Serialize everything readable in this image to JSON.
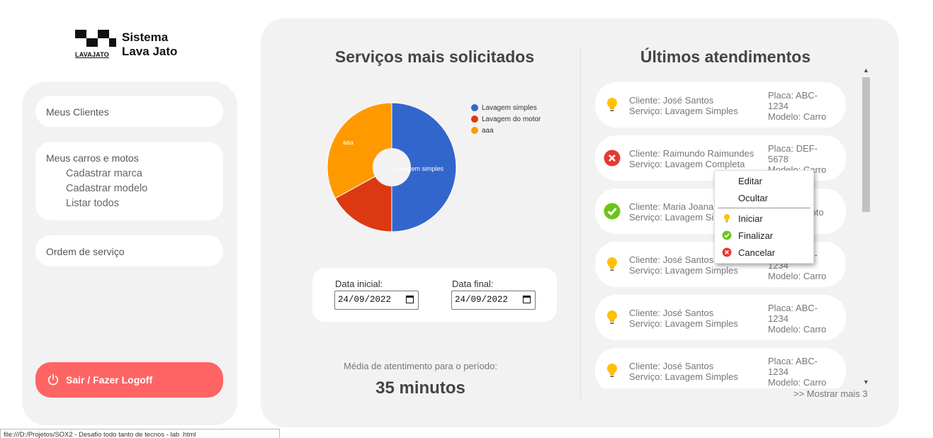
{
  "app": {
    "logo_line1": "Sistema",
    "logo_line2": "Lava Jato",
    "logo_badge": "LAVAJATO"
  },
  "sidebar": {
    "meus_clientes": "Meus Clientes",
    "carros_title": "Meus carros e motos",
    "carros_items": [
      "Cadastrar marca",
      "Cadastrar modelo",
      "Listar todos"
    ],
    "ordem_servico": "Ordem de serviço",
    "logoff_label": "Sair / Fazer Logoff"
  },
  "services": {
    "title": "Serviços mais solicitados",
    "legend": [
      "Lavagem simples",
      "Lavagem do motor",
      "aaa"
    ],
    "slice_labels": [
      "Lavagem simples",
      "aaa"
    ],
    "date_start_label": "Data inicial:",
    "date_start_value": "24/09/2022",
    "date_end_label": "Data final:",
    "date_end_value": "24/09/2022",
    "media_label": "Média de atentimento para o período:",
    "media_value": "35 minutos"
  },
  "chart_data": {
    "type": "pie",
    "title": "",
    "categories": [
      "Lavagem simples",
      "Lavagem do motor",
      "aaa"
    ],
    "values": [
      50,
      17,
      33
    ],
    "colors": [
      "#3366cc",
      "#dc3912",
      "#ff9900"
    ],
    "donut_hole": true,
    "legend_position": "top-right"
  },
  "atendimentos": {
    "title": "Últimos atendimentos",
    "items": [
      {
        "status_icon": "lightbulb-icon",
        "cliente": "Cliente: José Santos",
        "servico": "Serviço: Lavagem Simples",
        "placa": "Placa: ABC-1234",
        "modelo": "Modelo: Carro"
      },
      {
        "status_icon": "cancel-icon",
        "cliente": "Cliente: Raimundo Raimundes",
        "servico": "Serviço: Lavagem Completa",
        "placa": "Placa: DEF-5678",
        "modelo": "Modelo: Carro"
      },
      {
        "status_icon": "check-icon",
        "cliente": "Cliente: Maria Joana",
        "servico": "Serviço: Lavagem Simples",
        "placa": "Placa: ...",
        "modelo": "Modelo: Moto"
      },
      {
        "status_icon": "lightbulb-icon",
        "cliente": "Cliente: José Santos",
        "servico": "Serviço: Lavagem Simples",
        "placa": "Placa: ABC-1234",
        "modelo": "Modelo: Carro"
      },
      {
        "status_icon": "lightbulb-icon",
        "cliente": "Cliente: José Santos",
        "servico": "Serviço: Lavagem Simples",
        "placa": "Placa: ABC-1234",
        "modelo": "Modelo: Carro"
      },
      {
        "status_icon": "lightbulb-icon",
        "cliente": "Cliente: José Santos",
        "servico": "Serviço: Lavagem Simples",
        "placa": "Placa: ABC-1234",
        "modelo": "Modelo: Carro"
      }
    ],
    "more_link": ">> Mostrar mais 3"
  },
  "context_menu": {
    "editar": "Editar",
    "ocultar": "Ocultar",
    "iniciar": "Iniciar",
    "finalizar": "Finalizar",
    "cancelar": "Cancelar"
  },
  "statusbar": {
    "text": "file:///D:/Projetos/SOX2 - Desafio todo tanto de tecnos - lab .html"
  },
  "colors": {
    "logoff": "#ff6464",
    "panel_bg": "#f2f2f2",
    "warning": "#ffc107",
    "danger": "#e53935",
    "success": "#6cc417"
  }
}
